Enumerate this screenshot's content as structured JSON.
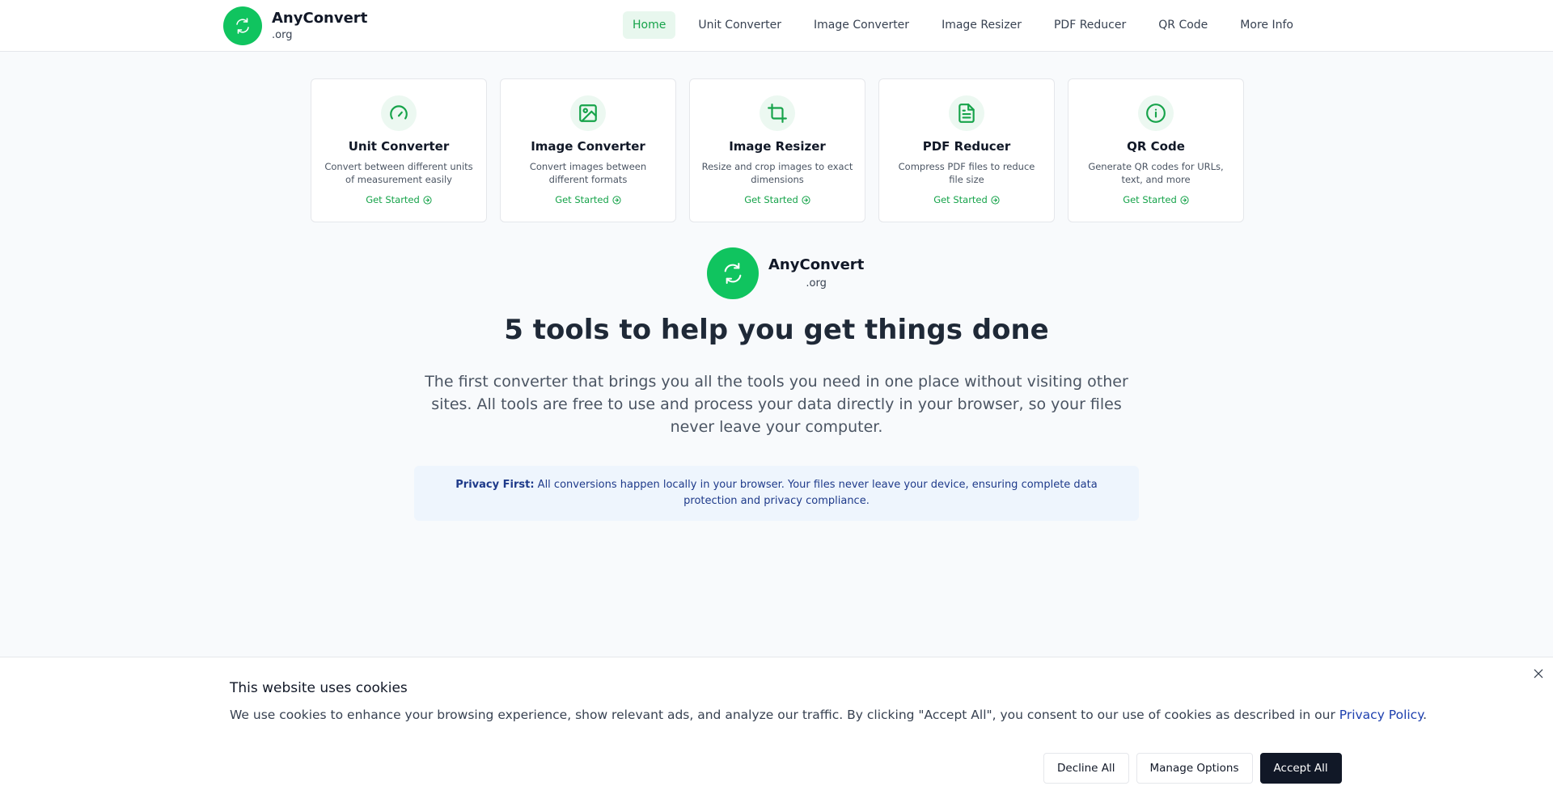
{
  "header": {
    "brand_name": "AnyConvert",
    "brand_tld": ".org",
    "nav": [
      {
        "label": "Home",
        "active": true
      },
      {
        "label": "Unit Converter"
      },
      {
        "label": "Image Converter"
      },
      {
        "label": "Image Resizer"
      },
      {
        "label": "PDF Reducer"
      },
      {
        "label": "QR Code"
      },
      {
        "label": "More Info"
      }
    ]
  },
  "tools": [
    {
      "icon": "gauge-icon",
      "title": "Unit Converter",
      "desc": "Convert between different units of measurement easily",
      "link": "Get Started"
    },
    {
      "icon": "image-icon",
      "title": "Image Converter",
      "desc": "Convert images between different formats",
      "link": "Get Started"
    },
    {
      "icon": "crop-icon",
      "title": "Image Resizer",
      "desc": "Resize and crop images to exact dimensions",
      "link": "Get Started"
    },
    {
      "icon": "file-text-icon",
      "title": "PDF Reducer",
      "desc": "Compress PDF files to reduce file size",
      "link": "Get Started"
    },
    {
      "icon": "info-icon",
      "title": "QR Code",
      "desc": "Generate QR codes for URLs, text, and more",
      "link": "Get Started"
    }
  ],
  "hero": {
    "brand_name": "AnyConvert",
    "brand_tld": ".org",
    "title": "5 tools to help you get things done",
    "description": "The first converter that brings you all the tools you need in one place without visiting other sites. All tools are free to use and process your data directly in your browser, so your files never leave your computer.",
    "privacy_label": "Privacy First:",
    "privacy_text": "All conversions happen locally in your browser. Your files never leave your device, ensuring complete data protection and privacy compliance."
  },
  "cookie": {
    "title": "This website uses cookies",
    "text": "We use cookies to enhance your browsing experience, show relevant ads, and analyze our traffic. By clicking \"Accept All\", you consent to our use of cookies as described in our ",
    "link": "Privacy Policy",
    "text_end": ".",
    "decline": "Decline All",
    "manage": "Manage Options",
    "accept": "Accept All"
  },
  "colors": {
    "brand_green": "#10c45f",
    "accent_green": "#16a34a",
    "privacy_bg": "#eef5fd",
    "privacy_text": "#1e3a8a",
    "primary_button": "#111827"
  }
}
